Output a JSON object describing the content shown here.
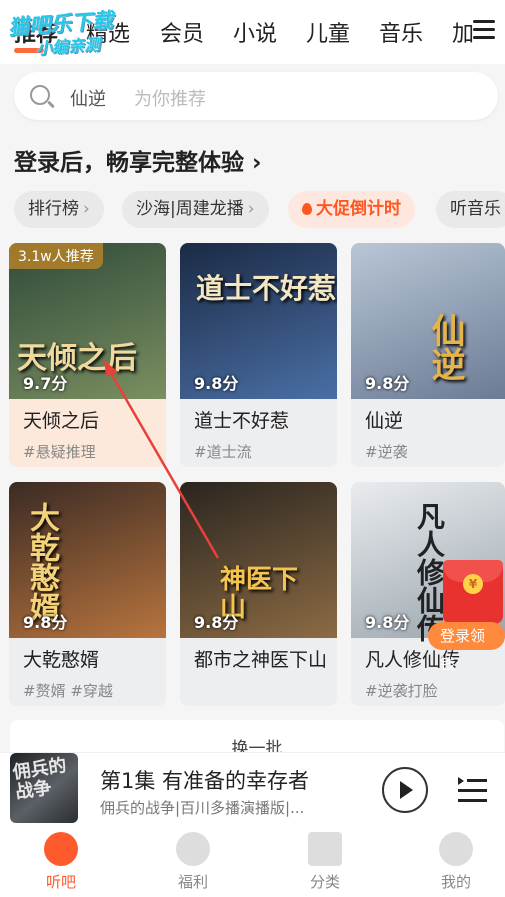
{
  "watermark": {
    "line1": "猫吧乐下载",
    "line2": "小编亲测"
  },
  "tabs": [
    {
      "label": "推荐",
      "active": true
    },
    {
      "label": "精选",
      "active": false
    },
    {
      "label": "会员",
      "active": false
    },
    {
      "label": "小说",
      "active": false
    },
    {
      "label": "儿童",
      "active": false
    },
    {
      "label": "音乐",
      "active": false
    },
    {
      "label": "加",
      "active": false
    }
  ],
  "search": {
    "keyword": "仙逆",
    "placeholder": "为你推荐"
  },
  "login_prompt": "登录后，畅享完整体验 ›",
  "chips": [
    {
      "label": "排行榜"
    },
    {
      "label": "沙海|周建龙播"
    },
    {
      "label": "大促倒计时"
    },
    {
      "label": "听音乐"
    }
  ],
  "books": [
    {
      "cover_text": "天倾之后",
      "score": "9.7分",
      "title": "天倾之后",
      "tags": "#悬疑推理",
      "badge": "3.1w人推荐",
      "colors": [
        "#2f4a3a",
        "#7b8f60"
      ]
    },
    {
      "cover_text": "道士不好惹",
      "score": "9.8分",
      "title": "道士不好惹",
      "tags": "#道士流",
      "badge": "",
      "colors": [
        "#1b2a45",
        "#4a6fa5"
      ]
    },
    {
      "cover_text": "仙逆",
      "score": "9.8分",
      "title": "仙逆",
      "tags": "#逆袭",
      "badge": "",
      "colors": [
        "#b9c6d6",
        "#6b7b95"
      ]
    },
    {
      "cover_text": "大乾憨婿",
      "score": "9.8分",
      "title": "大乾憨婿",
      "tags": "#赘婿  #穿越",
      "badge": "",
      "colors": [
        "#3b2b24",
        "#b8743e"
      ]
    },
    {
      "cover_text": "神医下山",
      "score": "9.8分",
      "title": "都市之神医下山",
      "tags": "",
      "badge": "",
      "colors": [
        "#2a2520",
        "#8c6b44"
      ]
    },
    {
      "cover_text": "凡人修仙传",
      "score": "9.8分",
      "title": "凡人修仙传",
      "tags": "#逆袭打脸",
      "badge": "",
      "colors": [
        "#e9ecef",
        "#9aa4ad"
      ]
    }
  ],
  "envelope": {
    "label": "登录领钱",
    "seal": "¥"
  },
  "refresh": {
    "label": "换一批"
  },
  "player": {
    "cover_text": "佣兵的战争",
    "title": "第1集 有准备的幸存者",
    "subtitle": "佣兵的战争|百川多播演播版|..."
  },
  "bottom_nav": [
    {
      "label": "听吧",
      "active": true
    },
    {
      "label": "福利",
      "active": false
    },
    {
      "label": "分类",
      "active": false
    },
    {
      "label": "我的",
      "active": false
    }
  ],
  "colors": {
    "accent": "#ff5a2c",
    "chip_hot_bg": "#fde7de",
    "annotation": "#e8413a"
  }
}
